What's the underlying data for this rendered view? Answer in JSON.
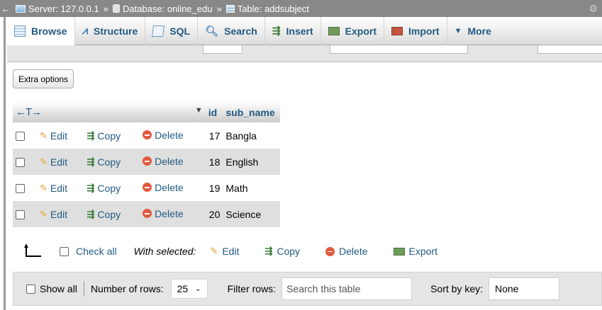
{
  "breadcrumb": {
    "back": "←",
    "server": "Server: 127.0.0.1",
    "sep1": "»",
    "database": "Database: online_edu",
    "sep2": "»",
    "table": "Table: addsubject"
  },
  "menu": {
    "tabs": [
      {
        "label": "Browse",
        "icon": "browse-icon"
      },
      {
        "label": "Structure",
        "icon": "structure-icon"
      },
      {
        "label": "SQL",
        "icon": "sql-icon"
      },
      {
        "label": "Search",
        "icon": "search-icon"
      },
      {
        "label": "Insert",
        "icon": "insert-icon"
      },
      {
        "label": "Export",
        "icon": "export-icon"
      },
      {
        "label": "Import",
        "icon": "import-icon"
      },
      {
        "label": "More",
        "icon": "chevron-down-icon"
      }
    ]
  },
  "extra_options": "Extra options",
  "table": {
    "arrows": "←T→",
    "columns": [
      "id",
      "sub_name"
    ],
    "actions": {
      "edit": "Edit",
      "copy": "Copy",
      "delete": "Delete"
    },
    "rows": [
      {
        "id": "17",
        "sub_name": "Bangla"
      },
      {
        "id": "18",
        "sub_name": "English"
      },
      {
        "id": "19",
        "sub_name": "Math"
      },
      {
        "id": "20",
        "sub_name": "Science"
      }
    ]
  },
  "bulk": {
    "check_all": "Check all",
    "with_selected": "With selected:",
    "edit": "Edit",
    "copy": "Copy",
    "delete": "Delete",
    "export": "Export"
  },
  "nav": {
    "show_all": "Show all",
    "rows_label": "Number of rows:",
    "rows_value": "25",
    "filter_label": "Filter rows:",
    "filter_placeholder": "Search this table",
    "sort_label": "Sort by key:",
    "sort_value": "None"
  }
}
